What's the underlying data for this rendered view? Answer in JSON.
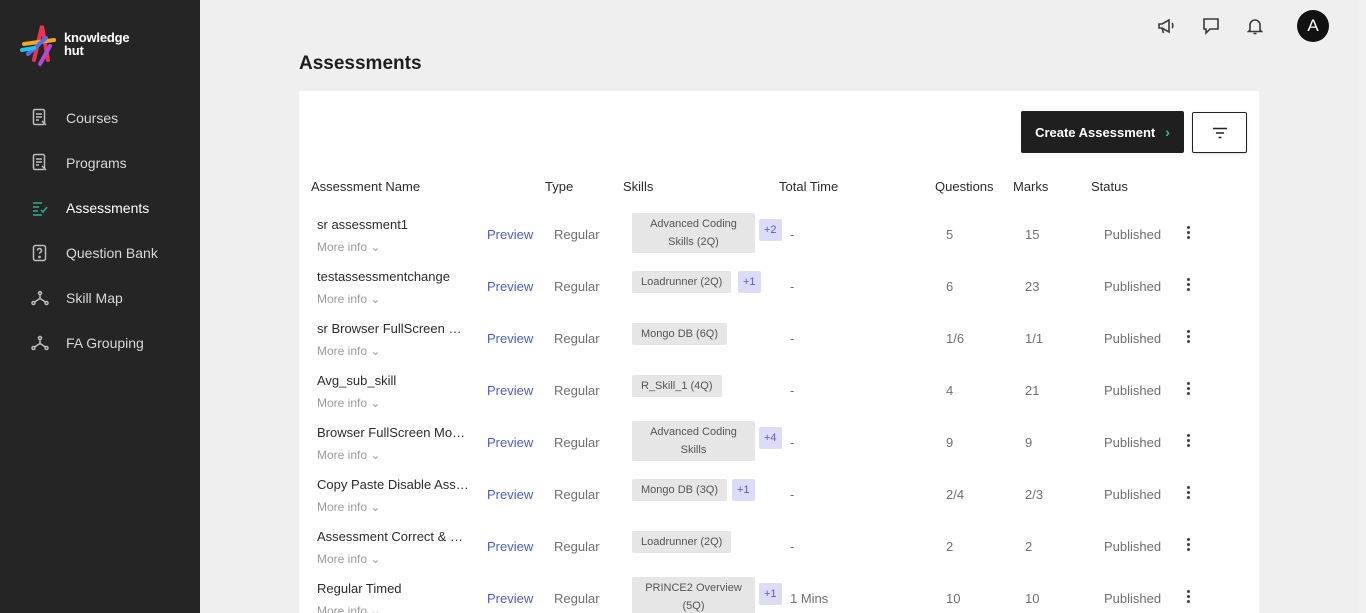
{
  "app": {
    "logo_text_line1": "knowledge",
    "logo_text_line2": "hut"
  },
  "sidebar": {
    "items": [
      {
        "label": "Courses",
        "icon": "courses-icon"
      },
      {
        "label": "Programs",
        "icon": "programs-icon"
      },
      {
        "label": "Assessments",
        "icon": "assessments-icon",
        "active": true
      },
      {
        "label": "Question Bank",
        "icon": "question-bank-icon"
      },
      {
        "label": "Skill Map",
        "icon": "skill-map-icon"
      },
      {
        "label": "FA Grouping",
        "icon": "fa-grouping-icon"
      }
    ]
  },
  "topbar": {
    "avatar_initial": "A"
  },
  "page": {
    "title": "Assessments"
  },
  "toolbar": {
    "create_label": "Create Assessment",
    "create_chevron": "›"
  },
  "table": {
    "headers": {
      "name": "Assessment Name",
      "type": "Type",
      "skills": "Skills",
      "time": "Total Time",
      "questions": "Questions",
      "marks": "Marks",
      "status": "Status"
    },
    "more_info": "More info ⌄",
    "preview": "Preview",
    "rows": [
      {
        "name": "sr assessment1",
        "type": "Regular",
        "skill": "Advanced Coding Skills (2Q)",
        "extra": "+2",
        "time": "-",
        "questions": "5",
        "marks": "15",
        "status": "Published"
      },
      {
        "name": "testassessmentchange",
        "type": "Regular",
        "skill": "Loadrunner (2Q)",
        "extra": "+1",
        "time": "-",
        "questions": "6",
        "marks": "23",
        "status": "Published"
      },
      {
        "name": "sr Browser FullScreen M...",
        "type": "Regular",
        "skill": "Mongo DB (6Q)",
        "extra": "",
        "time": "-",
        "questions": "1/6",
        "marks": "1/1",
        "status": "Published"
      },
      {
        "name": "Avg_sub_skill",
        "type": "Regular",
        "skill": "R_Skill_1 (4Q)",
        "extra": "",
        "time": "-",
        "questions": "4",
        "marks": "21",
        "status": "Published"
      },
      {
        "name": "Browser FullScreen Mod...",
        "type": "Regular",
        "skill": "Advanced Coding Skills",
        "extra": "+4",
        "time": "-",
        "questions": "9",
        "marks": "9",
        "status": "Published"
      },
      {
        "name": "Copy Paste Disable Asse...",
        "type": "Regular",
        "skill": "Mongo DB (3Q)",
        "extra": "+1",
        "time": "-",
        "questions": "2/4",
        "marks": "2/3",
        "status": "Published"
      },
      {
        "name": "Assessment Correct & w...",
        "type": "Regular",
        "skill": "Loadrunner (2Q)",
        "extra": "",
        "time": "-",
        "questions": "2",
        "marks": "2",
        "status": "Published"
      },
      {
        "name": "Regular Timed",
        "type": "Regular",
        "skill": "PRINCE2 Overview (5Q)",
        "extra": "+1",
        "time": "1 Mins",
        "questions": "10",
        "marks": "10",
        "status": "Published"
      }
    ]
  },
  "colors": {
    "sidebar_bg": "#252525",
    "accent": "#20b38d",
    "preview_link": "#4a5cc9",
    "badge_text": "#5b5bd6"
  }
}
